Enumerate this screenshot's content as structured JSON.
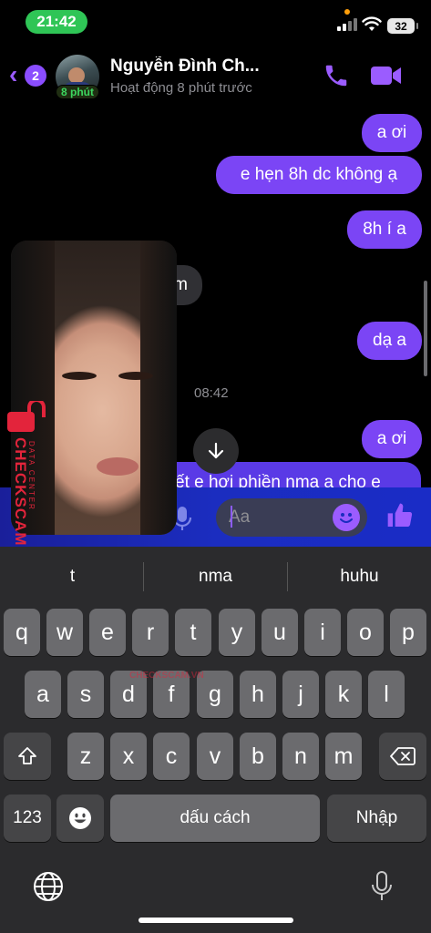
{
  "status_bar": {
    "time": "21:42",
    "battery": "32"
  },
  "header": {
    "back_badge": "2",
    "contact_name": "Nguyễn Đình Ch...",
    "active_badge": "8 phút",
    "status": "Hoạt động 8 phút trước"
  },
  "messages": [
    {
      "id": "m1",
      "text": "a ơi",
      "side": "right"
    },
    {
      "id": "m2",
      "text": "e hẹn 8h dc không ạ",
      "side": "right"
    },
    {
      "id": "m3",
      "text": "8h í a",
      "side": "right"
    },
    {
      "id": "m4",
      "text": "m",
      "side": "left"
    },
    {
      "id": "m5",
      "text": "dạ a",
      "side": "right"
    },
    {
      "id": "m6",
      "text": "a ơi",
      "side": "right"
    },
    {
      "id": "m7",
      "text": "ết e hơi phiền nma a cho e",
      "side": "right"
    }
  ],
  "timestamp": "08:42",
  "composer": {
    "placeholder": "Aa"
  },
  "watermark": {
    "brand": "CHECKSCAM.VN",
    "sub": "DATA CENTER"
  },
  "keyboard": {
    "suggestions": [
      "t",
      "nma",
      "huhu"
    ],
    "row1": [
      "q",
      "w",
      "e",
      "r",
      "t",
      "y",
      "u",
      "i",
      "o",
      "p"
    ],
    "row2": [
      "a",
      "s",
      "d",
      "f",
      "g",
      "h",
      "j",
      "k",
      "l"
    ],
    "row3": [
      "z",
      "x",
      "c",
      "v",
      "b",
      "n",
      "m"
    ],
    "numbers_key": "123",
    "space_key": "dấu cách",
    "return_key": "Nhập"
  },
  "colors": {
    "accent": "#7b45f5",
    "active_green": "#2fc556",
    "watermark_red": "#e3243b"
  },
  "icons": [
    "phone-icon",
    "video-camera-icon",
    "microphone-icon",
    "emoji-icon",
    "thumbs-up-icon",
    "globe-icon",
    "shift-icon",
    "backspace-icon",
    "chevron-down-icon"
  ]
}
